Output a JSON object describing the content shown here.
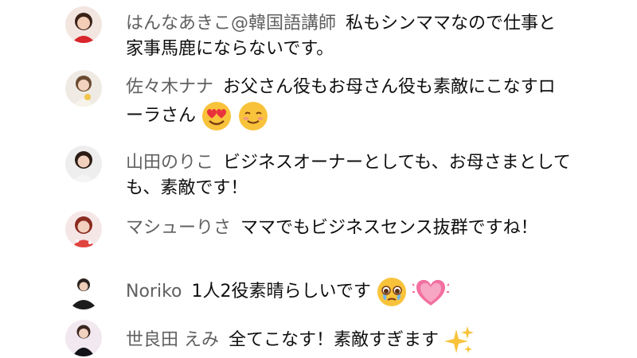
{
  "messages": [
    {
      "author": "はんなあきこ@韓国語講師",
      "text": "私もシンママなので仕事と家事馬鹿にならないです。",
      "emojis": []
    },
    {
      "author": "佐々木ナナ",
      "text": "お父さん役もお母さん役も素敵にこなすローラさん",
      "emojis": [
        "heart-eyes-emoji",
        "smiling-blush-emoji"
      ]
    },
    {
      "author": "山田のりこ",
      "text": "ビジネスオーナーとしても、お母さまとしても、素敵です！",
      "emojis": []
    },
    {
      "author": "マシューりさ",
      "text": "ママでもビジネスセンス抜群ですね！",
      "emojis": []
    },
    {
      "author": "Noriko",
      "text": "1人2役素晴らしいです",
      "emojis": [
        "pleading-tears-emoji",
        "growing-heart-emoji"
      ]
    },
    {
      "author": "世良田 えみ",
      "text": "全てこなす！素敵すぎます",
      "emojis": [
        "sparkles-emoji"
      ]
    }
  ],
  "colors": {
    "author_text": "#606060",
    "message_text": "#0f0f0f",
    "background": "#ffffff"
  }
}
